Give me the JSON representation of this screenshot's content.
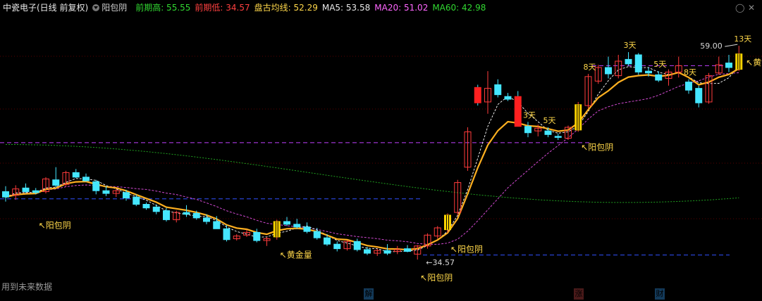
{
  "header": {
    "stock": "中瓷电子(日线 前复权)",
    "formula": "阳包阴",
    "items": [
      {
        "label": "前期高:",
        "value": "55.55",
        "color": "#31d831"
      },
      {
        "label": "前期低:",
        "value": "34.57",
        "color": "#ff4040"
      },
      {
        "label": "盘古均线:",
        "value": "52.29",
        "color": "#ffd84a"
      },
      {
        "label": "MA5:",
        "value": "53.58",
        "color": "#e8e8e8"
      },
      {
        "label": "MA20:",
        "value": "51.02",
        "color": "#ff66ff"
      },
      {
        "label": "MA60:",
        "value": "42.98",
        "color": "#31d831"
      }
    ]
  },
  "footer_text": "用到未来数据",
  "events": [
    {
      "label": "解",
      "color": "#2aa0ff"
    },
    {
      "label": "涨",
      "color": "#ff4a4a"
    },
    {
      "label": "财",
      "color": "#2aa0ff"
    }
  ],
  "chart_data": {
    "type": "candlestick",
    "ylim": [
      31.0,
      60.5
    ],
    "max_label": "59.00",
    "min_label": "34.57",
    "candles": [
      [
        40.9,
        41.5,
        39.8,
        40.3
      ],
      [
        40.5,
        41.6,
        40.0,
        41.2
      ],
      [
        41.3,
        41.8,
        40.7,
        40.9
      ],
      [
        41.0,
        41.3,
        40.6,
        40.8
      ],
      [
        40.9,
        42.5,
        40.7,
        42.3
      ],
      [
        42.2,
        43.6,
        41.4,
        41.6
      ],
      [
        41.7,
        43.2,
        41.5,
        43.0
      ],
      [
        43.0,
        43.4,
        42.4,
        42.5
      ],
      [
        42.5,
        42.9,
        42.0,
        42.1
      ],
      [
        42.0,
        42.2,
        40.6,
        41.0
      ],
      [
        41.0,
        41.5,
        40.4,
        40.7
      ],
      [
        40.7,
        41.2,
        40.3,
        41.0
      ],
      [
        40.8,
        41.1,
        39.9,
        40.2
      ],
      [
        40.3,
        40.6,
        39.3,
        39.5
      ],
      [
        39.5,
        39.7,
        38.9,
        39.1
      ],
      [
        39.2,
        39.5,
        38.4,
        38.7
      ],
      [
        38.8,
        39.1,
        37.6,
        37.8
      ],
      [
        37.8,
        38.8,
        37.5,
        38.6
      ],
      [
        38.6,
        39.4,
        38.1,
        38.4
      ],
      [
        38.5,
        38.8,
        37.8,
        38.0
      ],
      [
        38.0,
        38.4,
        37.3,
        37.6
      ],
      [
        37.6,
        38.2,
        37.0,
        36.8
      ],
      [
        36.8,
        37.2,
        35.4,
        35.6
      ],
      [
        35.7,
        36.2,
        35.5,
        36.0
      ],
      [
        36.1,
        36.7,
        35.9,
        36.4
      ],
      [
        36.4,
        36.8,
        35.3,
        35.5
      ],
      [
        35.5,
        35.9,
        34.9,
        35.7
      ],
      [
        35.9,
        37.8,
        35.6,
        37.6
      ],
      [
        37.6,
        38.1,
        37.1,
        37.3
      ],
      [
        37.3,
        37.9,
        36.8,
        37.0
      ],
      [
        37.0,
        37.5,
        36.3,
        36.5
      ],
      [
        36.5,
        36.9,
        35.6,
        35.8
      ],
      [
        35.8,
        36.2,
        34.9,
        35.1
      ],
      [
        35.1,
        35.4,
        34.3,
        34.6
      ],
      [
        34.6,
        35.5,
        34.4,
        35.4
      ],
      [
        35.4,
        35.7,
        34.3,
        34.5
      ],
      [
        34.5,
        34.8,
        33.9,
        34.1
      ],
      [
        34.1,
        34.6,
        33.8,
        34.4
      ],
      [
        34.4,
        35.1,
        33.9,
        34.1
      ],
      [
        34.3,
        34.9,
        34.0,
        34.5
      ],
      [
        34.6,
        35.0,
        34.2,
        34.3
      ],
      [
        34.0,
        35.0,
        33.4,
        34.9
      ],
      [
        34.9,
        36.3,
        34.6,
        36.1
      ],
      [
        36.0,
        37.1,
        35.7,
        36.9
      ],
      [
        36.7,
        38.5,
        36.4,
        38.3
      ],
      [
        38.6,
        42.2,
        38.3,
        41.9
      ],
      [
        43.6,
        48.0,
        43.2,
        47.5
      ],
      [
        52.4,
        52.7,
        50.4,
        50.7
      ],
      [
        50.8,
        54.2,
        49.5,
        52.3
      ],
      [
        52.7,
        53.3,
        51.3,
        51.6
      ],
      [
        51.4,
        51.8,
        50.9,
        51.1
      ],
      [
        51.4,
        52.0,
        49.1,
        48.1
      ],
      [
        48.1,
        48.6,
        46.9,
        47.4
      ],
      [
        47.6,
        48.3,
        47.0,
        47.9
      ],
      [
        47.6,
        48.0,
        46.9,
        47.2
      ],
      [
        47.0,
        47.3,
        46.6,
        46.9
      ],
      [
        46.8,
        48.2,
        46.6,
        48.0
      ],
      [
        47.7,
        50.8,
        47.5,
        50.5
      ],
      [
        50.4,
        53.9,
        50.1,
        53.6
      ],
      [
        53.1,
        54.9,
        52.8,
        54.6
      ],
      [
        54.6,
        55.8,
        53.4,
        53.9
      ],
      [
        53.7,
        56.0,
        53.4,
        55.3
      ],
      [
        55.5,
        56.3,
        54.8,
        55.0
      ],
      [
        56.0,
        56.2,
        53.8,
        54.1
      ],
      [
        54.2,
        54.6,
        53.6,
        54.0
      ],
      [
        53.8,
        54.2,
        53.0,
        53.2
      ],
      [
        53.4,
        54.4,
        52.6,
        54.1
      ],
      [
        54.1,
        55.8,
        53.5,
        54.8
      ],
      [
        53.0,
        53.3,
        51.7,
        52.1
      ],
      [
        52.3,
        52.6,
        50.2,
        50.7
      ],
      [
        50.8,
        54.0,
        50.6,
        53.7
      ],
      [
        54.0,
        55.8,
        53.8,
        54.9
      ],
      [
        55.1,
        56.0,
        54.1,
        54.6
      ],
      [
        54.4,
        57.0,
        54.2,
        56.1
      ]
    ],
    "red_marks": [
      47,
      51
    ],
    "yellow_marks": [
      27,
      44,
      57,
      73
    ],
    "annotations": [
      {
        "i": 3,
        "label": "阳包阴"
      },
      {
        "i": 27,
        "label": "黄金量"
      },
      {
        "i": 44,
        "label": "阳包阴"
      },
      {
        "i": 41,
        "label": "阳包阴"
      },
      {
        "i": 57,
        "label": "阳包阴"
      },
      {
        "i": 73,
        "label": "黄金量"
      }
    ],
    "day_labels": [
      {
        "i": 52,
        "label": "3天"
      },
      {
        "i": 54,
        "label": "5天"
      },
      {
        "i": 58,
        "label": "8天"
      },
      {
        "i": 62,
        "label": "3天"
      },
      {
        "i": 65,
        "label": "5天"
      },
      {
        "i": 68,
        "label": "8天"
      },
      {
        "i": 73,
        "label": "13天"
      }
    ],
    "hlines": [
      {
        "value": 46.3,
        "color": "#c040ff"
      },
      {
        "value": 40.1,
        "color": "#3050ff"
      },
      {
        "value": 33.9,
        "color": "#3050ff"
      },
      {
        "value": 54.8,
        "color": "#c040ff"
      }
    ]
  }
}
